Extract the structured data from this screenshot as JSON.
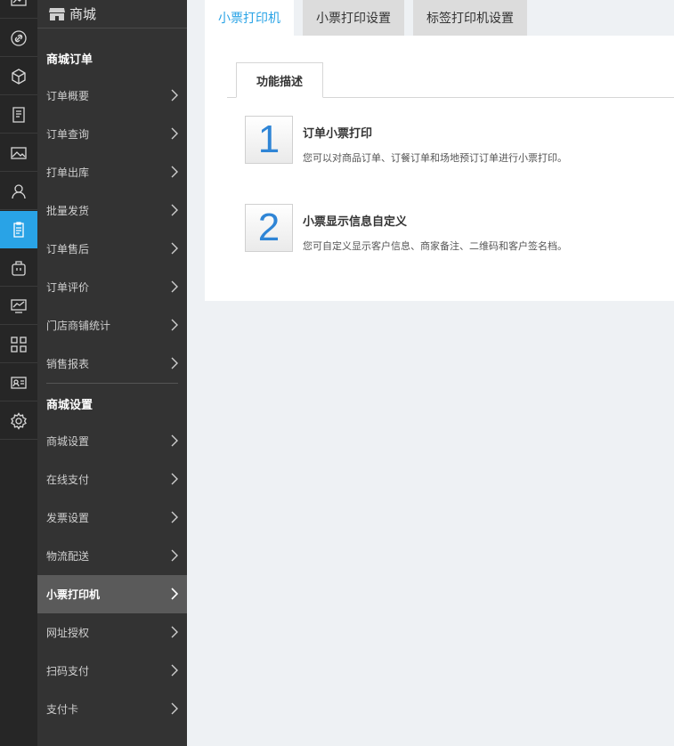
{
  "app": {
    "title": "商城"
  },
  "rail": {
    "icons": [
      "chart-icon",
      "link-icon",
      "box-icon",
      "document-icon",
      "image-icon",
      "user-icon",
      "clipboard-icon",
      "bag-icon",
      "monitor-chart-icon",
      "grid-icon",
      "id-card-icon",
      "gear-icon"
    ],
    "active_index": 6,
    "accent": "#29a3e6"
  },
  "menu": {
    "groups": [
      {
        "title": "商城订单",
        "items": [
          "订单概要",
          "订单查询",
          "打单出库",
          "批量发货",
          "订单售后",
          "订单评价",
          "门店商铺统计",
          "销售报表"
        ]
      },
      {
        "title": "商城设置",
        "items": [
          "商城设置",
          "在线支付",
          "发票设置",
          "物流配送",
          "小票打印机",
          "网址授权",
          "扫码支付",
          "支付卡"
        ]
      }
    ],
    "active_item": "小票打印机"
  },
  "tabs": [
    {
      "label": "小票打印机",
      "active": true
    },
    {
      "label": "小票打印设置",
      "active": false
    },
    {
      "label": "标签打印机设置",
      "active": false
    }
  ],
  "subtab": {
    "label": "功能描述"
  },
  "features": [
    {
      "number": "1",
      "title": "订单小票打印",
      "desc": "您可以对商品订单、订餐订单和场地预订订单进行小票打印。"
    },
    {
      "number": "2",
      "title": "小票显示信息自定义",
      "desc": "您可自定义显示客户信息、商家备注、二维码和客户签名档。"
    }
  ]
}
